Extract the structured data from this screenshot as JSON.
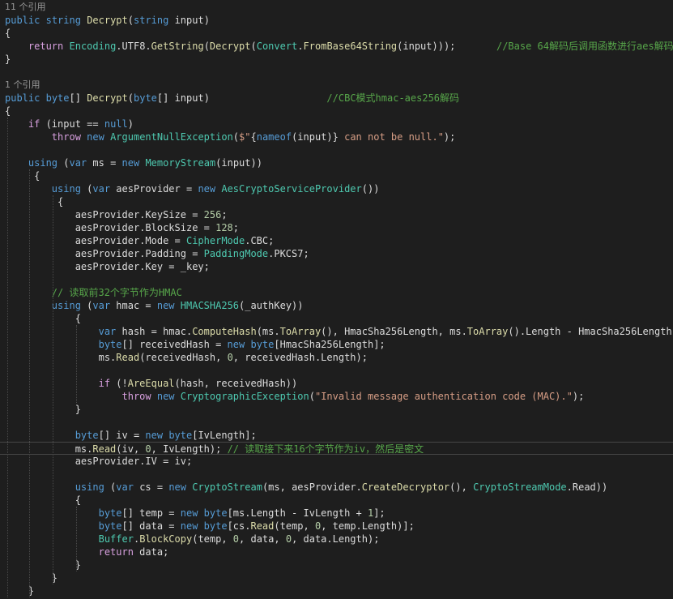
{
  "lines": [
    {
      "kind": "lens",
      "tokens": [
        {
          "t": "11 个引用",
          "c": "lens"
        }
      ]
    },
    {
      "tokens": [
        {
          "t": "public",
          "c": "kw"
        },
        {
          "t": " ",
          "c": "plain"
        },
        {
          "t": "string",
          "c": "kw"
        },
        {
          "t": " ",
          "c": "plain"
        },
        {
          "t": "Decrypt",
          "c": "method"
        },
        {
          "t": "(",
          "c": "plain"
        },
        {
          "t": "string",
          "c": "kw"
        },
        {
          "t": " input)",
          "c": "plain"
        }
      ]
    },
    {
      "tokens": [
        {
          "t": "{",
          "c": "plain"
        }
      ]
    },
    {
      "tokens": [
        {
          "t": "    ",
          "c": "plain"
        },
        {
          "t": "return",
          "c": "kw2"
        },
        {
          "t": " ",
          "c": "plain"
        },
        {
          "t": "Encoding",
          "c": "type"
        },
        {
          "t": ".UTF8.",
          "c": "plain"
        },
        {
          "t": "GetString",
          "c": "method"
        },
        {
          "t": "(",
          "c": "plain"
        },
        {
          "t": "Decrypt",
          "c": "method"
        },
        {
          "t": "(",
          "c": "plain"
        },
        {
          "t": "Convert",
          "c": "type"
        },
        {
          "t": ".",
          "c": "plain"
        },
        {
          "t": "FromBase64String",
          "c": "method"
        },
        {
          "t": "(input)));       ",
          "c": "plain"
        },
        {
          "t": "//Base 64解码后调用函数进行aes解码",
          "c": "cmt"
        }
      ]
    },
    {
      "tokens": [
        {
          "t": "}",
          "c": "plain"
        }
      ]
    },
    {
      "tokens": []
    },
    {
      "kind": "lens",
      "tokens": [
        {
          "t": "1 个引用",
          "c": "lens"
        }
      ]
    },
    {
      "tokens": [
        {
          "t": "public",
          "c": "kw"
        },
        {
          "t": " ",
          "c": "plain"
        },
        {
          "t": "byte",
          "c": "kw"
        },
        {
          "t": "[] ",
          "c": "plain"
        },
        {
          "t": "Decrypt",
          "c": "method"
        },
        {
          "t": "(",
          "c": "plain"
        },
        {
          "t": "byte",
          "c": "kw"
        },
        {
          "t": "[] input)                    ",
          "c": "plain"
        },
        {
          "t": "//CBC模式hmac-aes256解码",
          "c": "cmt"
        }
      ]
    },
    {
      "tokens": [
        {
          "t": "{",
          "c": "plain"
        }
      ]
    },
    {
      "tokens": [
        {
          "t": "    ",
          "c": "plain"
        },
        {
          "t": "if",
          "c": "kw2"
        },
        {
          "t": " (input == ",
          "c": "plain"
        },
        {
          "t": "null",
          "c": "kw"
        },
        {
          "t": ")",
          "c": "plain"
        }
      ]
    },
    {
      "tokens": [
        {
          "t": "        ",
          "c": "plain"
        },
        {
          "t": "throw",
          "c": "kw2"
        },
        {
          "t": " ",
          "c": "plain"
        },
        {
          "t": "new",
          "c": "kw"
        },
        {
          "t": " ",
          "c": "plain"
        },
        {
          "t": "ArgumentNullException",
          "c": "type"
        },
        {
          "t": "(",
          "c": "plain"
        },
        {
          "t": "$\"",
          "c": "str"
        },
        {
          "t": "{",
          "c": "plain"
        },
        {
          "t": "nameof",
          "c": "kw"
        },
        {
          "t": "(input)}",
          "c": "plain"
        },
        {
          "t": " can not be null.\"",
          "c": "str"
        },
        {
          "t": ");",
          "c": "plain"
        }
      ]
    },
    {
      "tokens": []
    },
    {
      "tokens": [
        {
          "t": "    ",
          "c": "plain"
        },
        {
          "t": "using",
          "c": "kw"
        },
        {
          "t": " (",
          "c": "plain"
        },
        {
          "t": "var",
          "c": "kw"
        },
        {
          "t": " ms = ",
          "c": "plain"
        },
        {
          "t": "new",
          "c": "kw"
        },
        {
          "t": " ",
          "c": "plain"
        },
        {
          "t": "MemoryStream",
          "c": "type"
        },
        {
          "t": "(input))",
          "c": "plain"
        }
      ]
    },
    {
      "tokens": [
        {
          "t": "     {",
          "c": "plain"
        }
      ]
    },
    {
      "tokens": [
        {
          "t": "        ",
          "c": "plain"
        },
        {
          "t": "using",
          "c": "kw"
        },
        {
          "t": " (",
          "c": "plain"
        },
        {
          "t": "var",
          "c": "kw"
        },
        {
          "t": " aesProvider = ",
          "c": "plain"
        },
        {
          "t": "new",
          "c": "kw"
        },
        {
          "t": " ",
          "c": "plain"
        },
        {
          "t": "AesCryptoServiceProvider",
          "c": "type"
        },
        {
          "t": "())",
          "c": "plain"
        }
      ]
    },
    {
      "tokens": [
        {
          "t": "         {",
          "c": "plain"
        }
      ]
    },
    {
      "tokens": [
        {
          "t": "            aesProvider.KeySize = ",
          "c": "plain"
        },
        {
          "t": "256",
          "c": "num"
        },
        {
          "t": ";",
          "c": "plain"
        }
      ]
    },
    {
      "tokens": [
        {
          "t": "            aesProvider.BlockSize = ",
          "c": "plain"
        },
        {
          "t": "128",
          "c": "num"
        },
        {
          "t": ";",
          "c": "plain"
        }
      ]
    },
    {
      "tokens": [
        {
          "t": "            aesProvider.Mode = ",
          "c": "plain"
        },
        {
          "t": "CipherMode",
          "c": "type"
        },
        {
          "t": ".CBC;",
          "c": "plain"
        }
      ]
    },
    {
      "tokens": [
        {
          "t": "            aesProvider.Padding = ",
          "c": "plain"
        },
        {
          "t": "PaddingMode",
          "c": "type"
        },
        {
          "t": ".PKCS7;",
          "c": "plain"
        }
      ]
    },
    {
      "tokens": [
        {
          "t": "            aesProvider.Key = _key;",
          "c": "plain"
        }
      ]
    },
    {
      "tokens": []
    },
    {
      "tokens": [
        {
          "t": "        ",
          "c": "plain"
        },
        {
          "t": "// 读取前32个字节作为HMAC",
          "c": "cmt"
        }
      ]
    },
    {
      "tokens": [
        {
          "t": "        ",
          "c": "plain"
        },
        {
          "t": "using",
          "c": "kw"
        },
        {
          "t": " (",
          "c": "plain"
        },
        {
          "t": "var",
          "c": "kw"
        },
        {
          "t": " hmac = ",
          "c": "plain"
        },
        {
          "t": "new",
          "c": "kw"
        },
        {
          "t": " ",
          "c": "plain"
        },
        {
          "t": "HMACSHA256",
          "c": "type"
        },
        {
          "t": "(_authKey))",
          "c": "plain"
        }
      ]
    },
    {
      "tokens": [
        {
          "t": "            {",
          "c": "plain"
        }
      ]
    },
    {
      "tokens": [
        {
          "t": "                ",
          "c": "plain"
        },
        {
          "t": "var",
          "c": "kw"
        },
        {
          "t": " hash = hmac.",
          "c": "plain"
        },
        {
          "t": "ComputeHash",
          "c": "method"
        },
        {
          "t": "(ms.",
          "c": "plain"
        },
        {
          "t": "ToArray",
          "c": "method"
        },
        {
          "t": "(), HmacSha256Length, ms.",
          "c": "plain"
        },
        {
          "t": "ToArray",
          "c": "method"
        },
        {
          "t": "().Length - HmacSha256Length);",
          "c": "plain"
        }
      ]
    },
    {
      "tokens": [
        {
          "t": "                ",
          "c": "plain"
        },
        {
          "t": "byte",
          "c": "kw"
        },
        {
          "t": "[] receivedHash = ",
          "c": "plain"
        },
        {
          "t": "new",
          "c": "kw"
        },
        {
          "t": " ",
          "c": "plain"
        },
        {
          "t": "byte",
          "c": "kw"
        },
        {
          "t": "[HmacSha256Length];",
          "c": "plain"
        }
      ]
    },
    {
      "tokens": [
        {
          "t": "                ms.",
          "c": "plain"
        },
        {
          "t": "Read",
          "c": "method"
        },
        {
          "t": "(receivedHash, ",
          "c": "plain"
        },
        {
          "t": "0",
          "c": "num"
        },
        {
          "t": ", receivedHash.Length);",
          "c": "plain"
        }
      ]
    },
    {
      "tokens": []
    },
    {
      "tokens": [
        {
          "t": "                ",
          "c": "plain"
        },
        {
          "t": "if",
          "c": "kw2"
        },
        {
          "t": " (!",
          "c": "plain"
        },
        {
          "t": "AreEqual",
          "c": "method"
        },
        {
          "t": "(hash, receivedHash))",
          "c": "plain"
        }
      ]
    },
    {
      "tokens": [
        {
          "t": "                    ",
          "c": "plain"
        },
        {
          "t": "throw",
          "c": "kw2"
        },
        {
          "t": " ",
          "c": "plain"
        },
        {
          "t": "new",
          "c": "kw"
        },
        {
          "t": " ",
          "c": "plain"
        },
        {
          "t": "CryptographicException",
          "c": "type"
        },
        {
          "t": "(",
          "c": "plain"
        },
        {
          "t": "\"Invalid message authentication code (MAC).\"",
          "c": "str"
        },
        {
          "t": ");",
          "c": "plain"
        }
      ]
    },
    {
      "tokens": [
        {
          "t": "            }",
          "c": "plain"
        }
      ]
    },
    {
      "tokens": []
    },
    {
      "tokens": [
        {
          "t": "            ",
          "c": "plain"
        },
        {
          "t": "byte",
          "c": "kw"
        },
        {
          "t": "[] iv = ",
          "c": "plain"
        },
        {
          "t": "new",
          "c": "kw"
        },
        {
          "t": " ",
          "c": "plain"
        },
        {
          "t": "byte",
          "c": "kw"
        },
        {
          "t": "[IvLength];",
          "c": "plain"
        }
      ]
    },
    {
      "kind": "current",
      "tokens": [
        {
          "t": "            ms.",
          "c": "plain"
        },
        {
          "t": "Read",
          "c": "method"
        },
        {
          "t": "(iv, ",
          "c": "plain"
        },
        {
          "t": "0",
          "c": "num"
        },
        {
          "t": ", IvLength); ",
          "c": "plain"
        },
        {
          "t": "// 读取接下来16个字节作为iv，然后是密文",
          "c": "cmt"
        }
      ]
    },
    {
      "tokens": [
        {
          "t": "            aesProvider.IV = iv;",
          "c": "plain"
        }
      ]
    },
    {
      "tokens": []
    },
    {
      "tokens": [
        {
          "t": "            ",
          "c": "plain"
        },
        {
          "t": "using",
          "c": "kw"
        },
        {
          "t": " (",
          "c": "plain"
        },
        {
          "t": "var",
          "c": "kw"
        },
        {
          "t": " cs = ",
          "c": "plain"
        },
        {
          "t": "new",
          "c": "kw"
        },
        {
          "t": " ",
          "c": "plain"
        },
        {
          "t": "CryptoStream",
          "c": "type"
        },
        {
          "t": "(ms, aesProvider.",
          "c": "plain"
        },
        {
          "t": "CreateDecryptor",
          "c": "method"
        },
        {
          "t": "(), ",
          "c": "plain"
        },
        {
          "t": "CryptoStreamMode",
          "c": "type"
        },
        {
          "t": ".Read))",
          "c": "plain"
        }
      ]
    },
    {
      "tokens": [
        {
          "t": "            {",
          "c": "plain"
        }
      ]
    },
    {
      "tokens": [
        {
          "t": "                ",
          "c": "plain"
        },
        {
          "t": "byte",
          "c": "kw"
        },
        {
          "t": "[] temp = ",
          "c": "plain"
        },
        {
          "t": "new",
          "c": "kw"
        },
        {
          "t": " ",
          "c": "plain"
        },
        {
          "t": "byte",
          "c": "kw"
        },
        {
          "t": "[ms.Length - IvLength + ",
          "c": "plain"
        },
        {
          "t": "1",
          "c": "num"
        },
        {
          "t": "];",
          "c": "plain"
        }
      ]
    },
    {
      "tokens": [
        {
          "t": "                ",
          "c": "plain"
        },
        {
          "t": "byte",
          "c": "kw"
        },
        {
          "t": "[] data = ",
          "c": "plain"
        },
        {
          "t": "new",
          "c": "kw"
        },
        {
          "t": " ",
          "c": "plain"
        },
        {
          "t": "byte",
          "c": "kw"
        },
        {
          "t": "[cs.",
          "c": "plain"
        },
        {
          "t": "Read",
          "c": "method"
        },
        {
          "t": "(temp, ",
          "c": "plain"
        },
        {
          "t": "0",
          "c": "num"
        },
        {
          "t": ", temp.Length)];",
          "c": "plain"
        }
      ]
    },
    {
      "tokens": [
        {
          "t": "                ",
          "c": "plain"
        },
        {
          "t": "Buffer",
          "c": "type"
        },
        {
          "t": ".",
          "c": "plain"
        },
        {
          "t": "BlockCopy",
          "c": "method"
        },
        {
          "t": "(temp, ",
          "c": "plain"
        },
        {
          "t": "0",
          "c": "num"
        },
        {
          "t": ", data, ",
          "c": "plain"
        },
        {
          "t": "0",
          "c": "num"
        },
        {
          "t": ", data.Length);",
          "c": "plain"
        }
      ]
    },
    {
      "tokens": [
        {
          "t": "                ",
          "c": "plain"
        },
        {
          "t": "return",
          "c": "kw2"
        },
        {
          "t": " data;",
          "c": "plain"
        }
      ]
    },
    {
      "tokens": [
        {
          "t": "            }",
          "c": "plain"
        }
      ]
    },
    {
      "tokens": [
        {
          "t": "        }",
          "c": "plain"
        }
      ]
    },
    {
      "tokens": [
        {
          "t": "    }",
          "c": "plain"
        }
      ]
    }
  ]
}
